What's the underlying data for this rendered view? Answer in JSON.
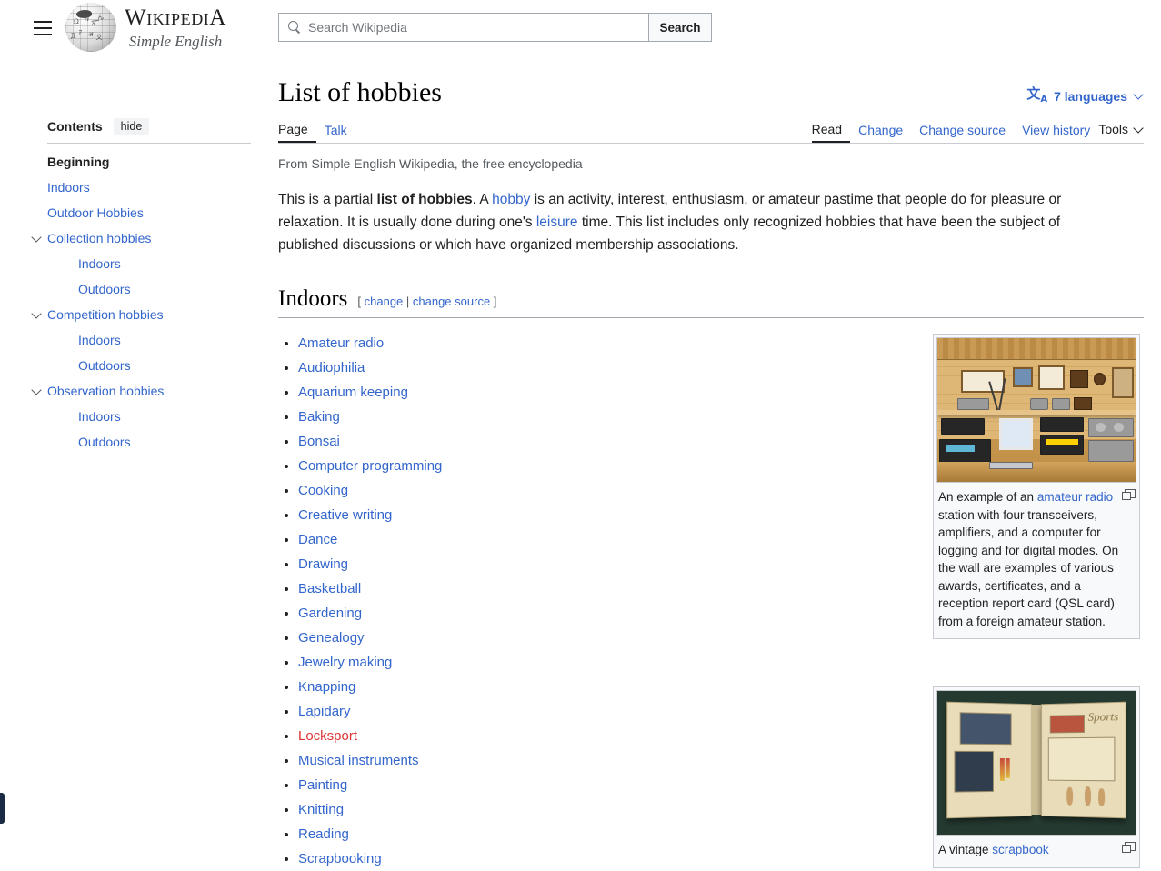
{
  "header": {
    "menu_icon": "hamburger-icon",
    "logo_word_main": "W",
    "logo_word_rest": "IKIPEDI",
    "logo_word_last": "A",
    "logo_wordmark": "WIKIPEDIA",
    "logo_tagline": "Simple English",
    "search": {
      "placeholder": "Search Wikipedia",
      "value": "",
      "button_label": "Search",
      "icon": "search-icon"
    }
  },
  "toc": {
    "title": "Contents",
    "hide_label": "hide",
    "items": [
      {
        "label": "Beginning",
        "level": 1,
        "active": true,
        "expandable": false
      },
      {
        "label": "Indoors",
        "level": 1,
        "active": false,
        "expandable": false
      },
      {
        "label": "Outdoor Hobbies",
        "level": 1,
        "active": false,
        "expandable": false
      },
      {
        "label": "Collection hobbies",
        "level": 1,
        "active": false,
        "expandable": true
      },
      {
        "label": "Indoors",
        "level": 2,
        "active": false,
        "expandable": false
      },
      {
        "label": "Outdoors",
        "level": 2,
        "active": false,
        "expandable": false
      },
      {
        "label": "Competition hobbies",
        "level": 1,
        "active": false,
        "expandable": true
      },
      {
        "label": "Indoors",
        "level": 2,
        "active": false,
        "expandable": false
      },
      {
        "label": "Outdoors",
        "level": 2,
        "active": false,
        "expandable": false
      },
      {
        "label": "Observation hobbies",
        "level": 1,
        "active": false,
        "expandable": true
      },
      {
        "label": "Indoors",
        "level": 2,
        "active": false,
        "expandable": false
      },
      {
        "label": "Outdoors",
        "level": 2,
        "active": false,
        "expandable": false
      }
    ]
  },
  "article": {
    "title": "List of hobbies",
    "language_button": {
      "icon": "language-icon",
      "label": "7 languages",
      "chevron": "chevron-down-icon"
    },
    "namespace_tabs": [
      {
        "label": "Page",
        "selected": true
      },
      {
        "label": "Talk",
        "selected": false
      }
    ],
    "view_tabs": [
      {
        "label": "Read",
        "selected": true
      },
      {
        "label": "Change",
        "selected": false
      },
      {
        "label": "Change source",
        "selected": false
      },
      {
        "label": "View history",
        "selected": false
      }
    ],
    "tools_label": "Tools",
    "siteline": "From Simple English Wikipedia, the free encyclopedia",
    "lead": {
      "p1": "This is a partial ",
      "bold": "list of hobbies",
      "p2": ". A ",
      "link_hobby": "hobby",
      "p3": " is an activity, interest, enthusiasm, or amateur pastime that people do for pleasure or relaxation. It is usually done during one's ",
      "link_leisure": "leisure",
      "p4": " time. This list includes only recognized hobbies that have been the subject of published discussions or which have organized membership associations."
    },
    "section": {
      "title": "Indoors",
      "edit_open": "[ ",
      "edit_change": "change",
      "edit_sep": " | ",
      "edit_change_source": "change source",
      "edit_close": " ]"
    },
    "indoors_list": [
      {
        "label": "Amateur radio",
        "red": false
      },
      {
        "label": "Audiophilia",
        "red": false
      },
      {
        "label": "Aquarium keeping",
        "red": false
      },
      {
        "label": "Baking",
        "red": false
      },
      {
        "label": "Bonsai",
        "red": false
      },
      {
        "label": "Computer programming",
        "red": false
      },
      {
        "label": "Cooking",
        "red": false
      },
      {
        "label": "Creative writing",
        "red": false
      },
      {
        "label": "Dance",
        "red": false
      },
      {
        "label": "Drawing",
        "red": false
      },
      {
        "label": "Basketball",
        "red": false
      },
      {
        "label": "Gardening",
        "red": false
      },
      {
        "label": "Genealogy",
        "red": false
      },
      {
        "label": "Jewelry making",
        "red": false
      },
      {
        "label": "Knapping",
        "red": false
      },
      {
        "label": "Lapidary",
        "red": false
      },
      {
        "label": "Locksport",
        "red": true
      },
      {
        "label": "Musical instruments",
        "red": false
      },
      {
        "label": "Painting",
        "red": false
      },
      {
        "label": "Knitting",
        "red": false
      },
      {
        "label": "Reading",
        "red": false
      },
      {
        "label": "Scrapbooking",
        "red": false
      }
    ],
    "thumbnails": [
      {
        "name": "amateur-radio-station",
        "caption_p1": "An example of an ",
        "caption_link": "amateur radio",
        "caption_p2": " station with four transceivers, amplifiers, and a computer for logging and for digital modes. On the wall are examples of various awards, certificates, and a reception report card (QSL card) from a foreign amateur station.",
        "magnify_icon": "expand-icon"
      },
      {
        "name": "vintage-scrapbook",
        "caption_p1": "A vintage ",
        "caption_link": "scrapbook",
        "caption_p2": "",
        "magnify_icon": "expand-icon"
      }
    ]
  },
  "colors": {
    "link": "#3366cc",
    "redlink": "#d33",
    "text": "#202122",
    "muted": "#54595d",
    "border": "#c8ccd1"
  }
}
